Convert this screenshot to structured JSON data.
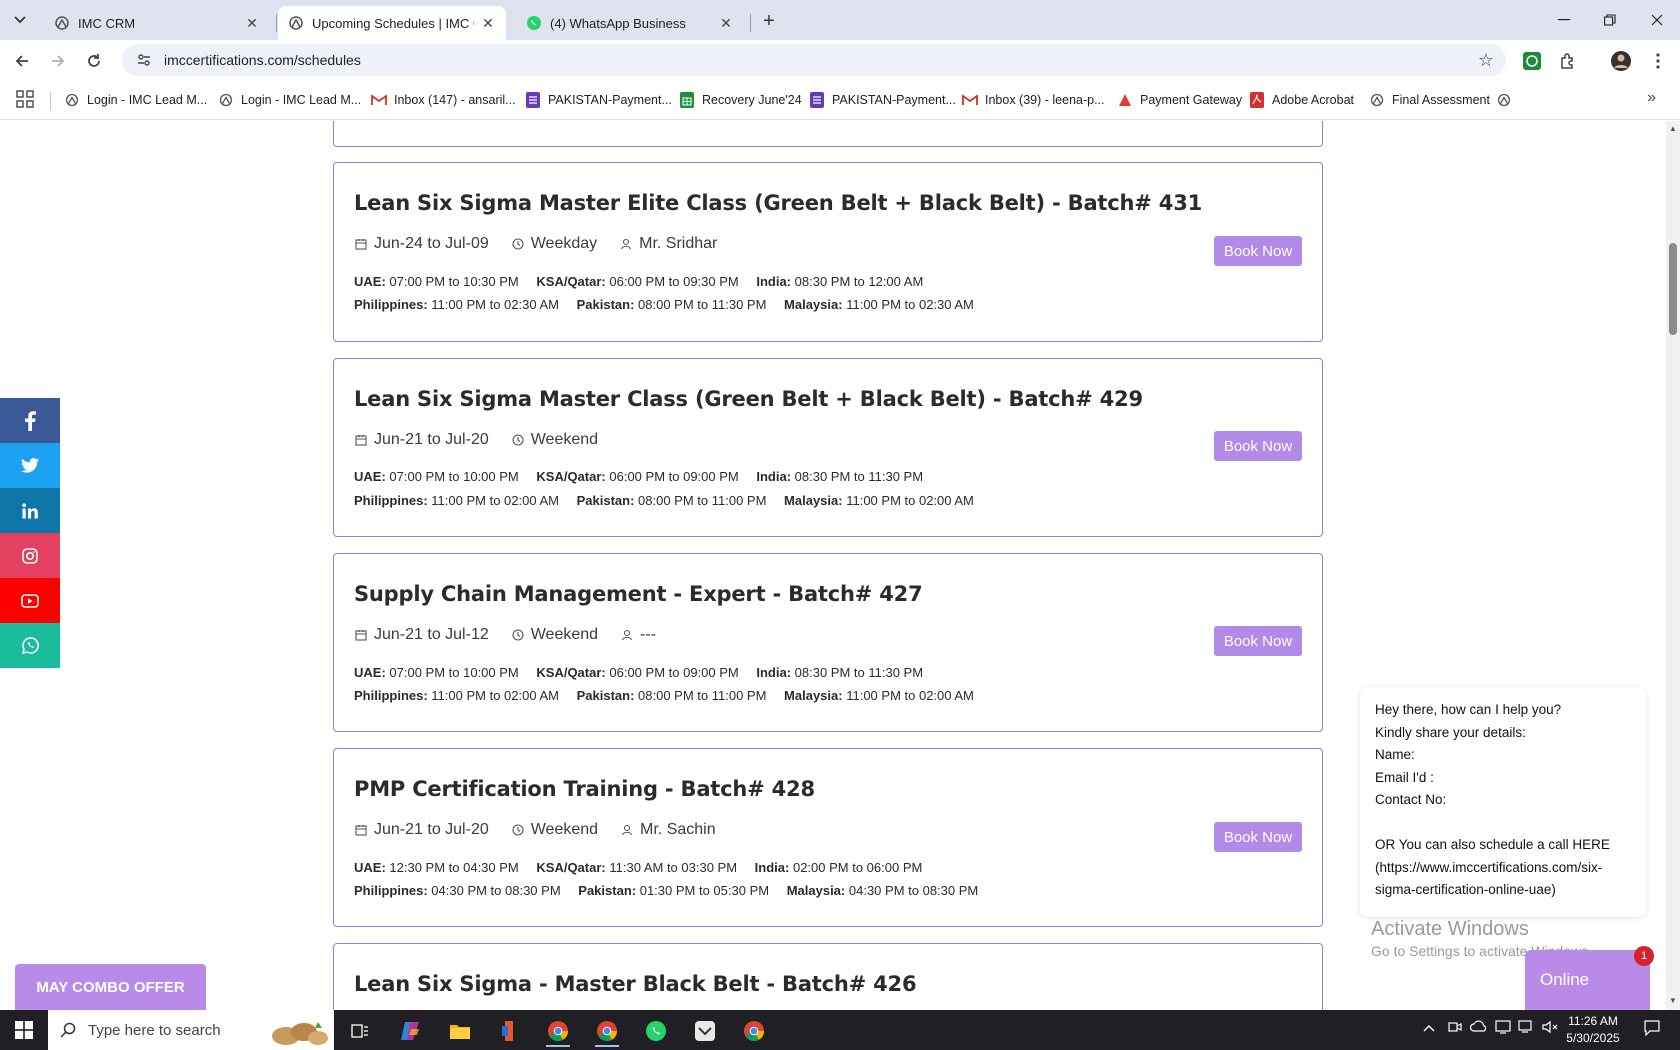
{
  "browser": {
    "tabs": [
      {
        "title": "IMC CRM",
        "active": false
      },
      {
        "title": "Upcoming Schedules | IMC Certi",
        "active": true
      },
      {
        "title": "(4) WhatsApp Business",
        "active": false
      }
    ],
    "url": "imccertifications.com/schedules",
    "bookmarks": [
      "Login - IMC Lead M...",
      "Login - IMC Lead M...",
      "Inbox (147) - ansaril...",
      "PAKISTAN-Payment...",
      "Recovery June'24",
      "PAKISTAN-Payment...",
      "Inbox (39) - leena-p...",
      "Payment Gateway",
      "Adobe Acrobat",
      "Final Assessment"
    ]
  },
  "schedules": [
    {
      "title": "Lean Six Sigma Master Elite Class (Green Belt + Black Belt) - Batch# 431",
      "dates": "Jun-24 to Jul-09",
      "mode": "Weekday",
      "trainer": "Mr. Sridhar",
      "row1": [
        {
          "label": "UAE:",
          "value": "07:00 PM to 10:30 PM"
        },
        {
          "label": "KSA/Qatar:",
          "value": "06:00 PM to 09:30 PM"
        },
        {
          "label": "India:",
          "value": "08:30 PM to 12:00 AM"
        }
      ],
      "row2": [
        {
          "label": "Philippines:",
          "value": "11:00 PM to 02:30 AM"
        },
        {
          "label": "Pakistan:",
          "value": "08:00 PM to 11:30 PM"
        },
        {
          "label": "Malaysia:",
          "value": "11:00 PM to 02:30 AM"
        }
      ],
      "button": "Book Now"
    },
    {
      "title": "Lean Six Sigma Master Class (Green Belt + Black Belt) - Batch# 429",
      "dates": "Jun-21 to Jul-20",
      "mode": "Weekend",
      "trainer": "",
      "row1": [
        {
          "label": "UAE:",
          "value": "07:00 PM to 10:00 PM"
        },
        {
          "label": "KSA/Qatar:",
          "value": "06:00 PM to 09:00 PM"
        },
        {
          "label": "India:",
          "value": "08:30 PM to 11:30 PM"
        }
      ],
      "row2": [
        {
          "label": "Philippines:",
          "value": "11:00 PM to 02:00 AM"
        },
        {
          "label": "Pakistan:",
          "value": "08:00 PM to 11:00 PM"
        },
        {
          "label": "Malaysia:",
          "value": "11:00 PM to 02:00 AM"
        }
      ],
      "button": "Book Now"
    },
    {
      "title": "Supply Chain Management - Expert - Batch# 427",
      "dates": "Jun-21 to Jul-12",
      "mode": "Weekend",
      "trainer": "---",
      "row1": [
        {
          "label": "UAE:",
          "value": "07:00 PM to 10:00 PM"
        },
        {
          "label": "KSA/Qatar:",
          "value": "06:00 PM to 09:00 PM"
        },
        {
          "label": "India:",
          "value": "08:30 PM to 11:30 PM"
        }
      ],
      "row2": [
        {
          "label": "Philippines:",
          "value": "11:00 PM to 02:00 AM"
        },
        {
          "label": "Pakistan:",
          "value": "08:00 PM to 11:00 PM"
        },
        {
          "label": "Malaysia:",
          "value": "11:00 PM to 02:00 AM"
        }
      ],
      "button": "Book Now"
    },
    {
      "title": "PMP Certification Training - Batch# 428",
      "dates": "Jun-21 to Jul-20",
      "mode": "Weekend",
      "trainer": "Mr. Sachin",
      "row1": [
        {
          "label": "UAE:",
          "value": "12:30 PM to 04:30 PM"
        },
        {
          "label": "KSA/Qatar:",
          "value": "11:30 AM to 03:30 PM"
        },
        {
          "label": "India:",
          "value": "02:00 PM to 06:00 PM"
        }
      ],
      "row2": [
        {
          "label": "Philippines:",
          "value": "04:30 PM to 08:30 PM"
        },
        {
          "label": "Pakistan:",
          "value": "01:30 PM to 05:30 PM"
        },
        {
          "label": "Malaysia:",
          "value": "04:30 PM to 08:30 PM"
        }
      ],
      "button": "Book Now"
    },
    {
      "title": "Lean Six Sigma - Master Black Belt - Batch# 426",
      "dates": "",
      "mode": "",
      "trainer": "",
      "row1": [],
      "row2": [],
      "button": ""
    }
  ],
  "social_colors": {
    "facebook": "#3b5998",
    "twitter": "#1da1f2",
    "linkedin": "#0e76a8",
    "instagram": "#e4405f",
    "youtube": "#ff0000",
    "whatsapp": "#1abc9c"
  },
  "combo_offer": "MAY COMBO OFFER",
  "chat": {
    "message": "Hey there, how can I help you?\nKindly share your details:\nName:\nEmail I'd :\nContact No:\n\nOR You can also schedule a call HERE\n(https://www.imccertifications.com/six-\nsigma-certification-online-uae)",
    "button": "Online",
    "badge": "1"
  },
  "activate_windows": {
    "line1": "Activate Windows",
    "line2": "Go to Settings to activate Windows."
  },
  "taskbar": {
    "search_placeholder": "Type here to search",
    "time": "11:26 AM",
    "date": "5/30/2025"
  },
  "accent": "#b28ae8"
}
